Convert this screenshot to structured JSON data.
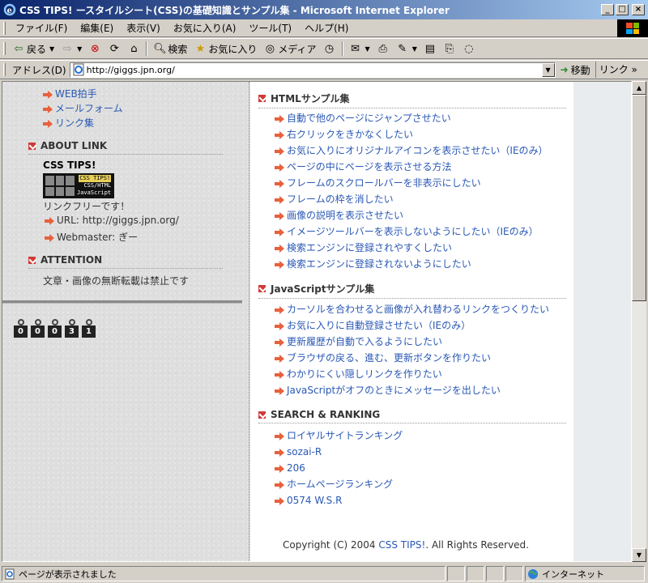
{
  "window": {
    "title": "CSS TIPS! ースタイルシート(CSS)の基礎知識とサンプル集 - Microsoft Internet Explorer",
    "min_label": "_",
    "max_label": "□",
    "close_label": "×"
  },
  "menubar": [
    "ファイル(F)",
    "編集(E)",
    "表示(V)",
    "お気に入り(A)",
    "ツール(T)",
    "ヘルプ(H)"
  ],
  "toolbar": {
    "back": "戻る",
    "search": "検索",
    "favorites": "お気に入り",
    "media": "メディア"
  },
  "address": {
    "label": "アドレス(D)",
    "url": "http://giggs.jpn.org/",
    "go": "移動",
    "links": "リンク"
  },
  "left": {
    "top_links": [
      "WEB拍手",
      "メールフォーム",
      "リンク集"
    ],
    "about_heading": "ABOUT LINK",
    "site_name": "CSS TIPS!",
    "banner_line1": "CSS TIPS!",
    "banner_line2": "CSS/HTML",
    "banner_line3": "JavaScript",
    "link_free": "リンクフリーです！",
    "url_item": "URL: http://giggs.jpn.org/",
    "webmaster_item": "Webmaster: ぎー",
    "attention_heading": "ATTENTION",
    "attention_text": "文章・画像の無断転載は禁止です",
    "counter_digits": [
      "0",
      "0",
      "0",
      "3",
      "1"
    ]
  },
  "right": {
    "html_heading": "HTMLサンプル集",
    "html_links": [
      "自動で他のページにジャンプさせたい",
      "右クリックをきかなくしたい",
      "お気に入りにオリジナルアイコンを表示させたい（IEのみ）",
      "ページの中にページを表示させる方法",
      "フレームのスクロールバーを非表示にしたい",
      "フレームの枠を消したい",
      "画像の説明を表示させたい",
      "イメージツールバーを表示しないようにしたい（IEのみ）",
      "検索エンジンに登録されやすくしたい",
      "検索エンジンに登録されないようにしたい"
    ],
    "js_heading": "JavaScriptサンプル集",
    "js_links": [
      "カーソルを合わせると画像が入れ替わるリンクをつくりたい",
      "お気に入りに自動登録させたい（IEのみ）",
      "更新履歴が自動で入るようにしたい",
      "ブラウザの戻る、進む、更新ボタンを作りたい",
      "わかりにくい隠しリンクを作りたい",
      "JavaScriptがオフのときにメッセージを出したい"
    ],
    "rank_heading": "SEARCH & RANKING",
    "rank_links": [
      "ロイヤルサイトランキング",
      "sozai-R",
      "206",
      "ホームページランキング",
      "0574 W.S.R"
    ],
    "copyright_prefix": "Copyright (C) 2004 ",
    "copyright_link": "CSS TIPS!",
    "copyright_suffix": ". All Rights Reserved."
  },
  "status": {
    "text": "ページが表示されました",
    "zone": "インターネット"
  }
}
